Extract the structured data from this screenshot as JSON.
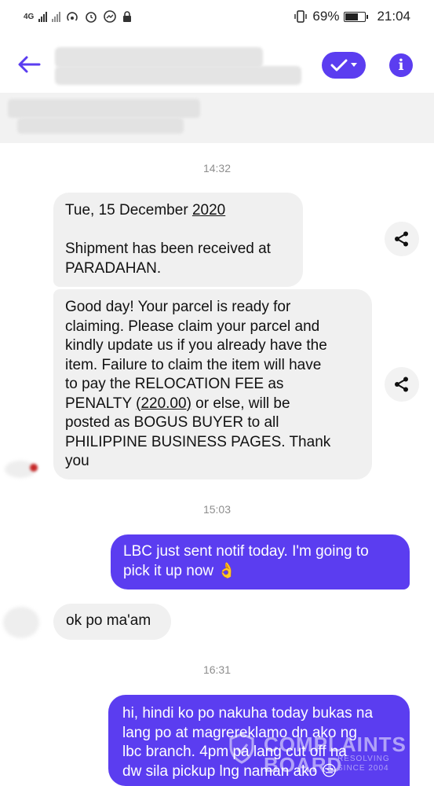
{
  "status_bar": {
    "network": "4G",
    "battery": "69%",
    "battery_level": 0.69,
    "time": "21:04"
  },
  "header": {
    "back_icon": "arrow-left-icon",
    "verify_icon": "check-icon",
    "info_icon": "info-icon",
    "info_glyph": "i",
    "accent": "#5b3df0"
  },
  "messages": [
    {
      "type": "timestamp",
      "text": "14:32"
    },
    {
      "type": "incoming",
      "lines": [
        "Tue, 15 December 2020",
        "",
        "Shipment has been received at",
        "PARADAHAN."
      ]
    },
    {
      "type": "incoming",
      "lines": [
        "Good day!  Your parcel is ready for",
        "claiming. Please claim your parcel and",
        "kindly update us if you already have the",
        "item. Failure to claim the item will have",
        "to pay the RELOCATION FEE as",
        "PENALTY (220.00) or else, will be",
        "posted as BOGUS BUYER to all",
        "PHILIPPINE BUSINESS PAGES. Thank",
        "you"
      ]
    },
    {
      "type": "timestamp",
      "text": "15:03"
    },
    {
      "type": "outgoing",
      "lines": [
        "LBC just sent notif today. I'm going to",
        "pick it up now 👌"
      ]
    },
    {
      "type": "incoming",
      "lines": [
        "ok po ma'am"
      ]
    },
    {
      "type": "timestamp",
      "text": "16:31"
    },
    {
      "type": "outgoing",
      "lines": [
        "hi, hindi ko po nakuha today bukas na",
        "lang po at magrereklamo dn ako ng",
        "lbc branch. 4pm pa lang cut off na",
        "dw sila pickup lng naman ako 😒"
      ]
    }
  ],
  "watermark": {
    "line1": "COMPLAINTS",
    "line2": "BOARD",
    "tag1": "RESOLVING",
    "tag2": "SINCE 2004"
  }
}
